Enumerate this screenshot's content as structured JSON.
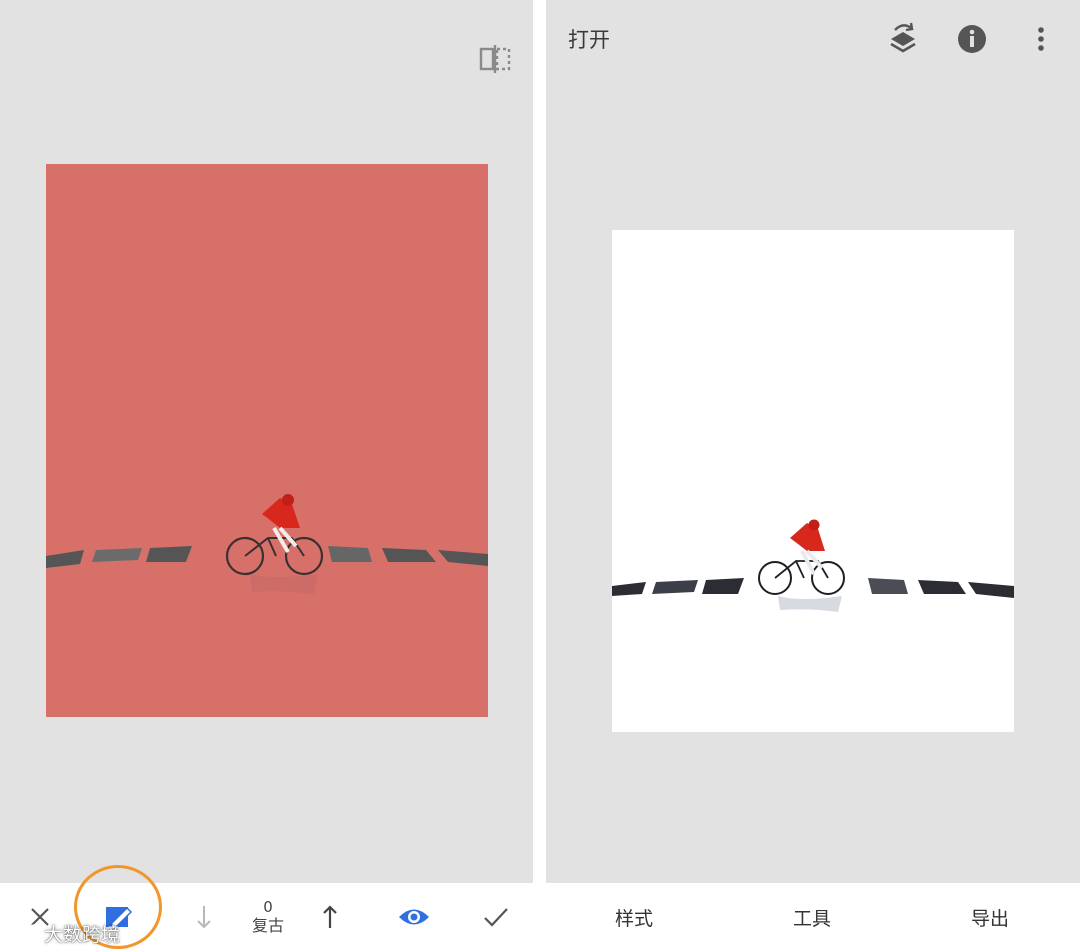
{
  "colors": {
    "panel_bg": "#e2e2e2",
    "mask_overlay": "#d8706a",
    "accent_blue": "#2f6fe0",
    "highlight_ring": "#f0962b",
    "rider_red": "#d8281e"
  },
  "left_panel": {
    "toolbar": {
      "cancel_icon": "close-icon",
      "mask_icon": "brush-mask-icon",
      "decrease_icon": "arrow-down-icon",
      "strength_value": "0",
      "strength_label": "复古",
      "increase_icon": "arrow-up-icon",
      "visibility_icon": "eye-icon",
      "apply_icon": "checkmark-icon"
    },
    "compare_icon": "compare-split-icon"
  },
  "right_panel": {
    "header": {
      "open_label": "打开",
      "stack_icon": "layers-undo-icon",
      "info_icon": "info-icon",
      "menu_icon": "more-vert-icon"
    },
    "tabs": [
      {
        "label": "样式"
      },
      {
        "label": "工具"
      },
      {
        "label": "导出"
      }
    ]
  },
  "watermark": {
    "text": "大数跨境",
    "logo_icon": "watermark-logo-icon"
  }
}
